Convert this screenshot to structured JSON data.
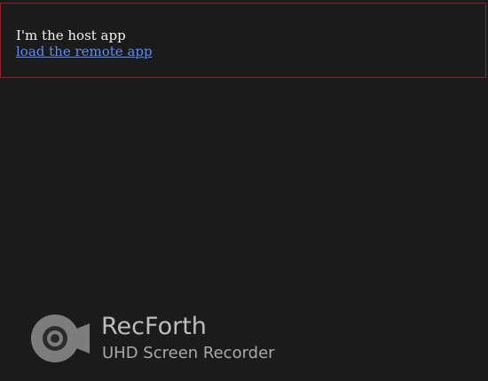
{
  "host": {
    "message": "I'm the host app",
    "link_label": "load the remote app"
  },
  "watermark": {
    "title": "RecForth",
    "subtitle": "UHD Screen Recorder",
    "logo_icon": "camera-icon"
  },
  "colors": {
    "background": "#1b1b1b",
    "container_border": "#8f1f2a",
    "link": "#5a8df7",
    "text": "#f2f2f2"
  }
}
